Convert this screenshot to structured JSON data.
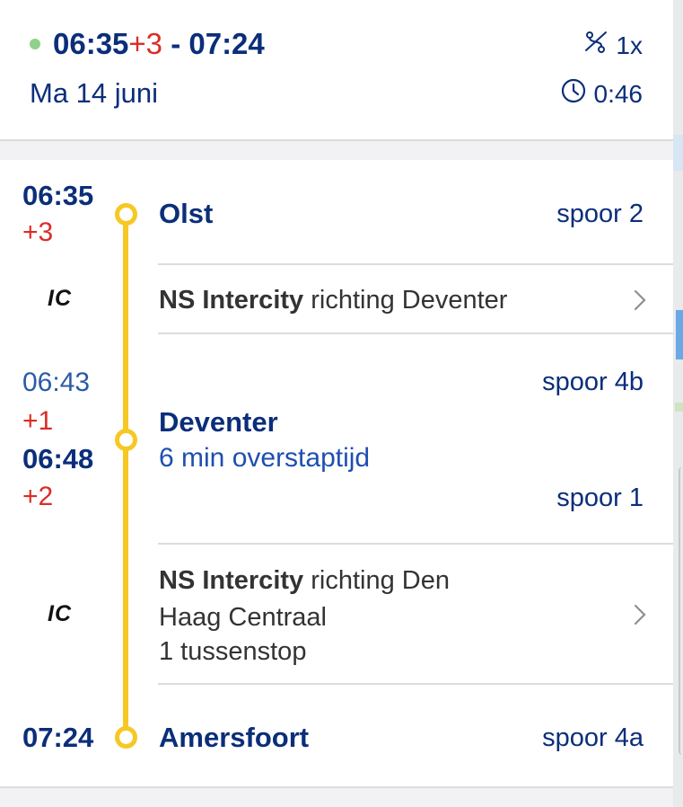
{
  "header": {
    "departure": "06:35",
    "departure_delay": "+3",
    "separator": " - ",
    "arrival": "07:24",
    "date": "Ma 14 juni",
    "transfers": "1x",
    "duration": "0:46",
    "status_color": "#8fd18a"
  },
  "stops": {
    "olst": {
      "time": "06:35",
      "delay": "+3",
      "name": "Olst",
      "platform": "spoor 2"
    },
    "deventer": {
      "arr_time": "06:43",
      "arr_delay": "+1",
      "dep_time": "06:48",
      "dep_delay": "+2",
      "name": "Deventer",
      "transfer_time": "6 min overstaptijd",
      "arr_platform": "spoor 4b",
      "dep_platform": "spoor 1"
    },
    "amersfoort": {
      "time": "07:24",
      "name": "Amersfoort",
      "platform": "spoor 4a"
    }
  },
  "legs": [
    {
      "type": "IC",
      "operator": "NS Intercity",
      "direction": " richting Deventer"
    },
    {
      "type": "IC",
      "operator": "NS Intercity",
      "direction": " richting Den",
      "direction_cont": "Haag Centraal",
      "stops": "1 tussenstop"
    }
  ],
  "colors": {
    "brand_blue": "#0b2e7a",
    "delay_red": "#db2d27",
    "route_yellow": "#f7c724"
  },
  "icons": {
    "transfers": "transfer-icon",
    "duration": "clock-icon",
    "leg": "chevron-right-icon"
  }
}
